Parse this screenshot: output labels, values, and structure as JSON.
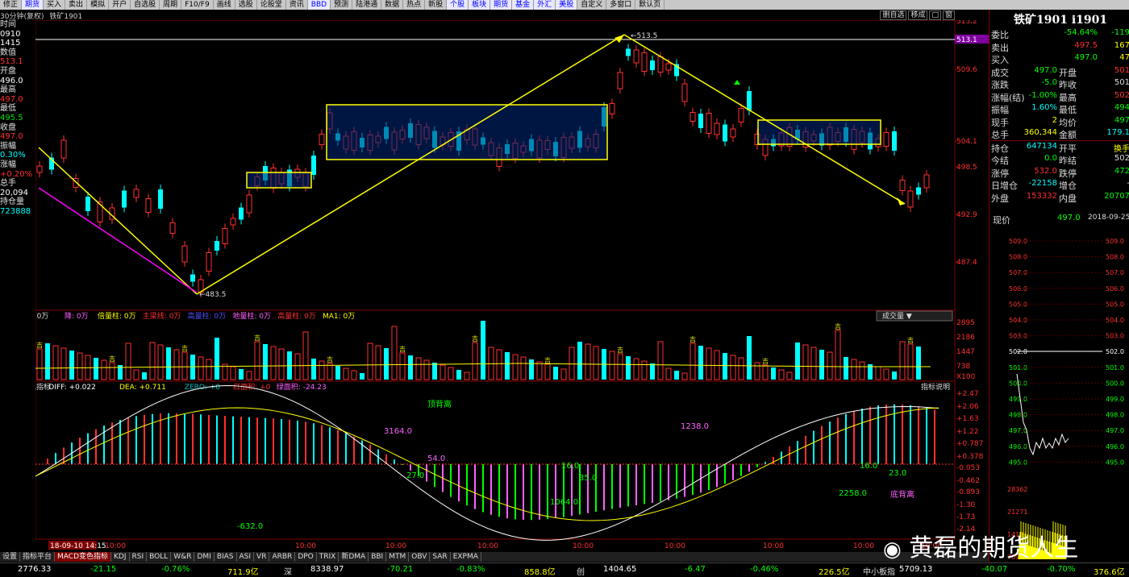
{
  "toolbar": [
    "修正",
    "期货",
    "买入",
    "卖出",
    "模拟",
    "开户",
    "自选股",
    "周期",
    "F10/F9",
    "画线",
    "选股",
    "论股堂",
    "资讯",
    "BBD",
    "预测",
    "陆港通",
    "数据",
    "热点",
    "新股",
    "个股",
    "板块",
    "期货",
    "基金",
    "外汇",
    "美股",
    "自定义",
    "多窗口",
    "默认页"
  ],
  "toolbar_highlight": [
    "BBD",
    "个股",
    "板块",
    "期货",
    "基金",
    "外汇",
    "美股"
  ],
  "window": {
    "period": "30分钟(复权)",
    "name": "铁矿1901"
  },
  "ctrl_buttons": [
    "删自选",
    "移成",
    "□",
    "窗"
  ],
  "left_info": [
    {
      "t": "时间",
      "c": "#e0e0e0"
    },
    {
      "t": "0910",
      "c": "#fff"
    },
    {
      "t": "1415",
      "c": "#fff"
    },
    {
      "t": "数值",
      "c": "#e0e0e0"
    },
    {
      "t": "513.1",
      "c": "#ff3030"
    },
    {
      "t": "开盘",
      "c": "#e0e0e0"
    },
    {
      "t": "496.0",
      "c": "#fff"
    },
    {
      "t": "最高",
      "c": "#e0e0e0"
    },
    {
      "t": "497.0",
      "c": "#ff3030"
    },
    {
      "t": "最低",
      "c": "#e0e0e0"
    },
    {
      "t": "495.5",
      "c": "#00e000"
    },
    {
      "t": "收盘",
      "c": "#e0e0e0"
    },
    {
      "t": "497.0",
      "c": "#ff3030"
    },
    {
      "t": "振幅",
      "c": "#e0e0e0"
    },
    {
      "t": "0.30%",
      "c": "#00ffff"
    },
    {
      "t": "涨幅",
      "c": "#e0e0e0"
    },
    {
      "t": "+0.20%",
      "c": "#ff3030"
    },
    {
      "t": "总手",
      "c": "#e0e0e0"
    },
    {
      "t": "20,094",
      "c": "#fff"
    },
    {
      "t": "持仓量",
      "c": "#e0e0e0"
    },
    {
      "t": "723888",
      "c": "#00ffff"
    }
  ],
  "price_axis": [
    "515.2",
    "513.1",
    "509.6",
    "504.1",
    "498.5",
    "492.9",
    "487.4"
  ],
  "vol_axis": [
    "2895",
    "2186",
    "1447",
    "738",
    "X100"
  ],
  "macd_axis": [
    "+2.47",
    "+2.06",
    "+1.63",
    "+1.22",
    "+0.787",
    "+0.378",
    "-0.053",
    "-0.462",
    "-0.893",
    "-1.30",
    "-1.73",
    "-2.14"
  ],
  "annotations": {
    "high": "513.5",
    "low": "483.5"
  },
  "vol_header": [
    {
      "t": "VOLUME: 0万",
      "c": "#ddd"
    },
    {
      "t": "降: 0万",
      "c": "#ff60ff"
    },
    {
      "t": "倍量柱: 0万",
      "c": "#ffff00"
    },
    {
      "t": "主梁线: 0万",
      "c": "#ff3030"
    },
    {
      "t": "高量柱: 0万",
      "c": "#5050ff"
    },
    {
      "t": "地量柱: 0万",
      "c": "#ff60ff"
    },
    {
      "t": "高量柱: 0万",
      "c": "#ff3030"
    },
    {
      "t": "MA1: 0万",
      "c": "#ffff00"
    }
  ],
  "vol_dropdown": "成交量",
  "vol_bar_label": "吉",
  "macd_header": [
    {
      "t": "MACD变色指标",
      "c": "#ddd"
    },
    {
      "t": "DIFF: +0.022",
      "c": "#fff"
    },
    {
      "t": "DEA: +0.711",
      "c": "#ffff00"
    },
    {
      "t": "ZERO: +0",
      "c": "#00c0c0"
    },
    {
      "t": "红面积: +0",
      "c": "#ff3030"
    },
    {
      "t": "绿面积: -24.23",
      "c": "#ff60ff"
    }
  ],
  "macd_help": "指标说明",
  "macd_labels": [
    {
      "t": "顶背离",
      "c": "#00ff00"
    },
    {
      "t": "3164.0",
      "c": "#ff60ff"
    },
    {
      "t": "54.0",
      "c": "#ff60ff"
    },
    {
      "t": "27.0",
      "c": "#00ff00"
    },
    {
      "t": "16.0",
      "c": "#00ff00"
    },
    {
      "t": "35.0",
      "c": "#00ff00"
    },
    {
      "t": "1064.0",
      "c": "#00ff00"
    },
    {
      "t": "1238.0",
      "c": "#ff60ff"
    },
    {
      "t": "-632.0",
      "c": "#00ff00"
    },
    {
      "t": "16.0",
      "c": "#00ff00"
    },
    {
      "t": "23.0",
      "c": "#00ff00"
    },
    {
      "t": "2258.0",
      "c": "#00ff00"
    },
    {
      "t": "底背离",
      "c": "#ff60ff"
    }
  ],
  "time_axis": [
    "10:00",
    "18-09-10 14:15",
    "10:00",
    "10:00",
    "10:00",
    "10:00",
    "10:00",
    "10:00",
    "10:00",
    "10:00",
    "10:00"
  ],
  "bottom_tabs": [
    "设置",
    "指标平台",
    "MACD变色指标",
    "KDJ",
    "RSI",
    "BOLL",
    "W&R",
    "DMI",
    "BIAS",
    "ASI",
    "VR",
    "ARBR",
    "DPO",
    "TRIX",
    "新DMA",
    "BBI",
    "MTM",
    "OBV",
    "SAR",
    "EXPMA"
  ],
  "status_bar": [
    {
      "t": "2776.33",
      "c": "#fff"
    },
    {
      "t": "-21.15",
      "c": "#00ff00"
    },
    {
      "t": "-0.76%",
      "c": "#00ff00"
    },
    {
      "t": "711.9亿",
      "c": "#ffff00"
    },
    {
      "t": "深",
      "c": "#ddd"
    },
    {
      "t": "8338.97",
      "c": "#fff"
    },
    {
      "t": "-70.21",
      "c": "#00ff00"
    },
    {
      "t": "-0.83%",
      "c": "#00ff00"
    },
    {
      "t": "858.8亿",
      "c": "#ffff00"
    },
    {
      "t": "创",
      "c": "#ddd"
    },
    {
      "t": "1404.65",
      "c": "#fff"
    },
    {
      "t": "-6.47",
      "c": "#00ff00"
    },
    {
      "t": "-0.46%",
      "c": "#00ff00"
    },
    {
      "t": "226.5亿",
      "c": "#ffff00"
    },
    {
      "t": "中小板指",
      "c": "#ddd"
    },
    {
      "t": "5709.13",
      "c": "#fff"
    },
    {
      "t": "-40.07",
      "c": "#00ff00"
    },
    {
      "t": "-0.70%",
      "c": "#00ff00"
    },
    {
      "t": "376.6亿",
      "c": "#ffff00"
    }
  ],
  "quote": {
    "title": "铁矿1901 i1901",
    "rows": [
      {
        "l": "委比",
        "v": "-54.64%",
        "vc": "#00ff00",
        "r": "-119",
        "rc": "#00ff00"
      },
      {
        "l": "卖出",
        "v": "497.5",
        "vc": "#ff3030",
        "r": "167",
        "rc": "#ffff00"
      },
      {
        "l": "买入",
        "v": "497.0",
        "vc": "#00ff00",
        "r": "47",
        "rc": "#ffff00"
      },
      {
        "l": "成交",
        "v": "497.0",
        "vc": "#00ff00",
        "l2": "开盘",
        "r": "501",
        "rc": "#ff3030"
      },
      {
        "l": "涨跌",
        "v": "-5.0",
        "vc": "#00ff00",
        "l2": "昨收",
        "r": "501",
        "rc": "#ddd"
      },
      {
        "l": "涨幅(结)",
        "v": "-1.00%",
        "vc": "#00ff00",
        "l2": "最高",
        "r": "502",
        "rc": "#ff3030"
      },
      {
        "l": "振幅",
        "v": "1.60%",
        "vc": "#00ffff",
        "l2": "最低",
        "r": "494",
        "rc": "#00ff00"
      },
      {
        "l": "现手",
        "v": "2",
        "vc": "#ffff00",
        "l2": "均价",
        "r": "497",
        "rc": "#00ff00"
      },
      {
        "l": "总手",
        "v": "360,344",
        "vc": "#ffff00",
        "l2": "金额",
        "r": "179.1",
        "rc": "#00ffff"
      },
      {
        "l": "持仓",
        "v": "647134",
        "vc": "#00ffff",
        "l2": "开平",
        "r": "换手",
        "rc": "#ffff00"
      },
      {
        "l": "今结",
        "v": "0.0",
        "vc": "#00ff00",
        "l2": "昨结",
        "r": "502",
        "rc": "#ddd"
      },
      {
        "l": "涨停",
        "v": "532.0",
        "vc": "#ff3030",
        "l2": "跌停",
        "r": "472",
        "rc": "#00ff00"
      },
      {
        "l": "日增仓",
        "v": "-22158",
        "vc": "#00ffff",
        "l2": "增仓",
        "r": "-",
        "rc": "#ddd"
      },
      {
        "l": "外盘",
        "v": "153332",
        "vc": "#ff3030",
        "l2": "内盘",
        "r": "20707",
        "rc": "#00ff00"
      }
    ],
    "current_label": "现价",
    "current_value": "497.0",
    "current_date": "2018-09-25,",
    "mini_axis_left": [
      "509.0",
      "508.0",
      "507.0",
      "506.0",
      "505.0",
      "504.0",
      "503.0",
      "502.0",
      "501.0",
      "500.0",
      "499.0",
      "498.0",
      "497.0",
      "496.0",
      "495.0"
    ],
    "mini_axis_right": [
      "1.39%",
      "1.19%",
      "0.99%",
      "0.79%",
      "0.59%",
      "0.39%",
      "0.19%",
      "0.00%",
      "0.20%",
      "0.39%",
      "0.59%",
      "0.79%",
      "0.99%",
      "1.19%",
      "1.39%"
    ],
    "mini_vol_axis": [
      "28362",
      "21271",
      "14181",
      "7090"
    ]
  },
  "watermark": "黄磊的期货人生"
}
